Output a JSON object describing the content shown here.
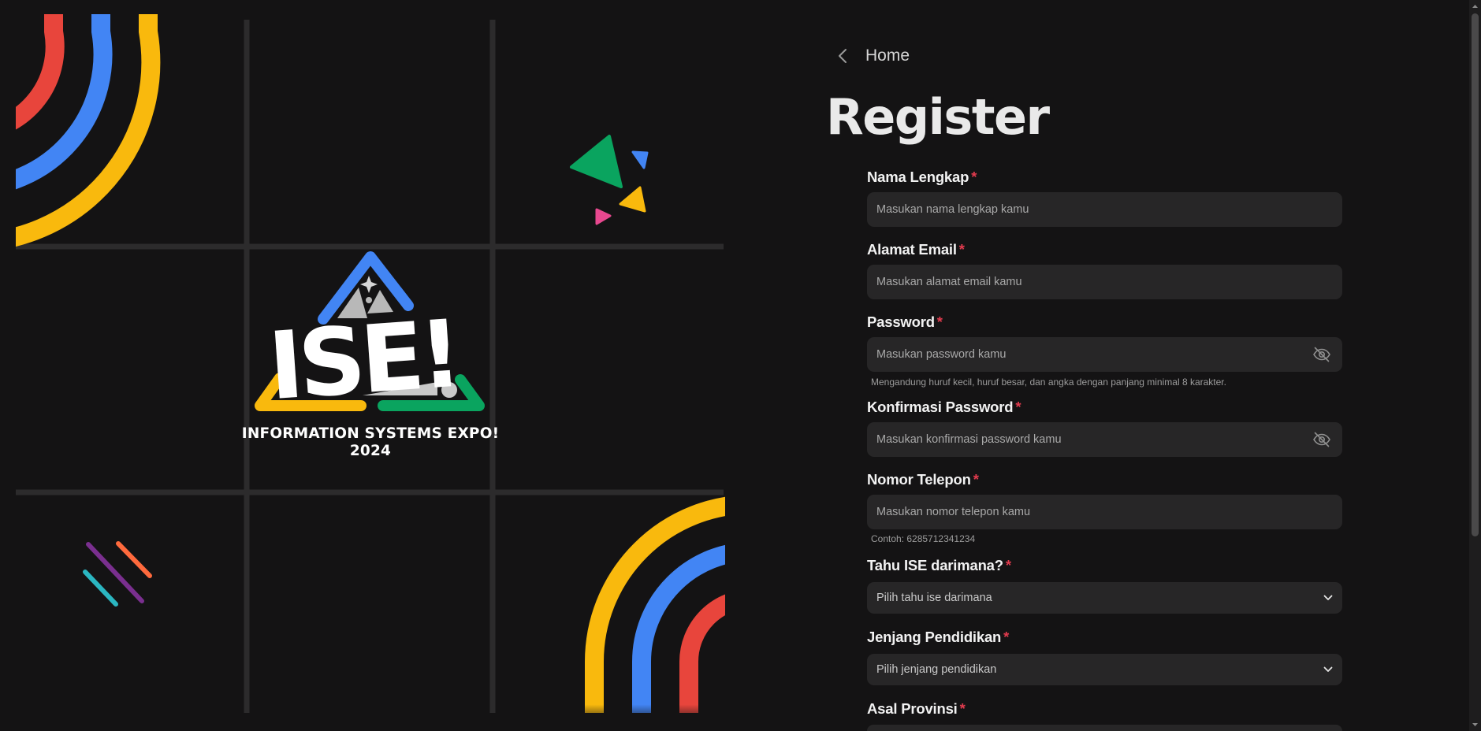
{
  "brand": {
    "logo_text": "ISE!",
    "tagline": "INFORMATION SYSTEMS EXPO!",
    "year": "2024"
  },
  "nav": {
    "back_label": "Home",
    "back_icon": "chevron-left-icon"
  },
  "page_title": "Register",
  "form": {
    "full_name": {
      "label": "Nama Lengkap",
      "required": "*",
      "placeholder": "Masukan nama lengkap kamu"
    },
    "email": {
      "label": "Alamat Email",
      "required": "*",
      "placeholder": "Masukan alamat email kamu"
    },
    "password": {
      "label": "Password",
      "required": "*",
      "placeholder": "Masukan password kamu",
      "hint": "Mengandung huruf kecil, huruf besar, dan angka dengan panjang minimal 8 karakter.",
      "toggle_icon": "eye-off-icon"
    },
    "confirm_password": {
      "label": "Konfirmasi Password",
      "required": "*",
      "placeholder": "Masukan konfirmasi password kamu",
      "toggle_icon": "eye-off-icon"
    },
    "phone": {
      "label": "Nomor Telepon",
      "required": "*",
      "placeholder": "Masukan nomor telepon kamu",
      "hint": "Contoh: 6285712341234"
    },
    "source": {
      "label": "Tahu ISE darimana?",
      "required": "*",
      "selected": "Pilih tahu ise darimana"
    },
    "education": {
      "label": "Jenjang Pendidikan",
      "required": "*",
      "selected": "Pilih jenjang pendidikan"
    },
    "province": {
      "label": "Asal Provinsi",
      "required": "*"
    }
  },
  "colors": {
    "background": "#141314",
    "input_bg": "#272627",
    "required": "#e23b4e",
    "brand_red": "#e8453c",
    "brand_blue": "#4285f4",
    "brand_yellow": "#f9b90d",
    "brand_green": "#0aa45f",
    "brand_pink": "#e8488f"
  }
}
